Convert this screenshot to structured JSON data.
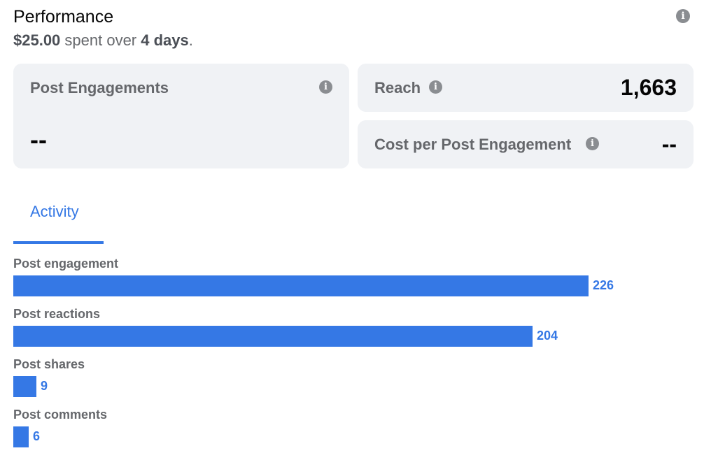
{
  "header": {
    "title": "Performance",
    "spend_amount": "$25.00",
    "spend_middle": " spent over ",
    "spend_duration": "4 days",
    "spend_end": "."
  },
  "cards": {
    "engagements": {
      "label": "Post Engagements",
      "value": "--"
    },
    "reach": {
      "label": "Reach",
      "value": "1,663"
    },
    "cost": {
      "label": "Cost per Post Engagement",
      "value": "--"
    }
  },
  "tabs": {
    "activity": "Activity"
  },
  "icons": {
    "info": "info-icon"
  },
  "colors": {
    "accent": "#3578e5",
    "card_bg": "#f0f2f5",
    "icon_gray": "#8a8d91"
  },
  "chart_data": {
    "type": "bar",
    "categories": [
      "Post engagement",
      "Post reactions",
      "Post shares",
      "Post comments"
    ],
    "values": [
      226,
      204,
      9,
      6
    ]
  }
}
